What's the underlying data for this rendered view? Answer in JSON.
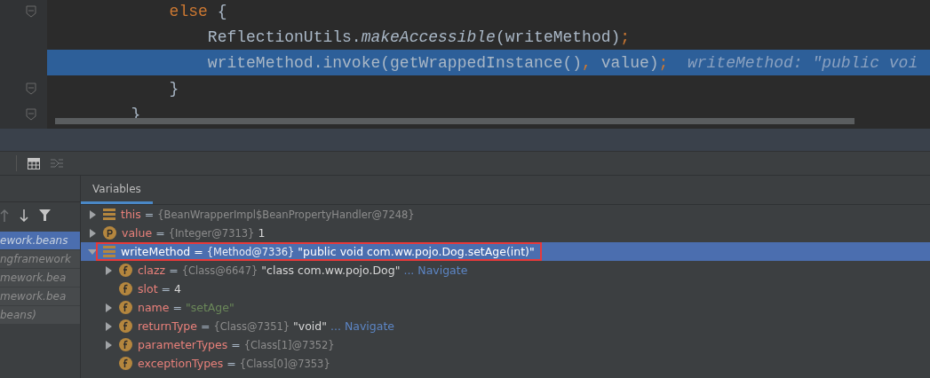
{
  "editor": {
    "lines": [
      {
        "highlighted": false,
        "fold": true,
        "segments": [
          {
            "kind": "keyword",
            "text": "            else"
          },
          {
            "kind": "plain",
            "text": " {"
          }
        ]
      },
      {
        "highlighted": false,
        "fold": false,
        "segments": [
          {
            "kind": "plain",
            "text": "                ReflectionUtils."
          },
          {
            "kind": "italic",
            "text": "makeAccessible"
          },
          {
            "kind": "plain",
            "text": "(writeMethod)"
          },
          {
            "kind": "punct",
            "text": ";"
          }
        ]
      },
      {
        "highlighted": true,
        "fold": false,
        "segments": [
          {
            "kind": "plain",
            "text": "                writeMethod.invoke(getWrappedInstance()"
          },
          {
            "kind": "punct",
            "text": ","
          },
          {
            "kind": "plain",
            "text": " value)"
          },
          {
            "kind": "punct",
            "text": ";"
          },
          {
            "kind": "hint",
            "text": "  writeMethod: \"public voi"
          }
        ]
      },
      {
        "highlighted": false,
        "fold": true,
        "segments": [
          {
            "kind": "plain",
            "text": "            }"
          }
        ]
      },
      {
        "highlighted": false,
        "fold": true,
        "segments": [
          {
            "kind": "plain",
            "text": "        }"
          }
        ]
      }
    ]
  },
  "frames": {
    "items": [
      {
        "label": "ework.beans",
        "selected": true
      },
      {
        "label": "ngframework",
        "selected": false
      },
      {
        "label": "mework.bea",
        "selected": false
      },
      {
        "label": "mework.bea",
        "selected": false
      },
      {
        "label": "beans)",
        "selected": false
      }
    ]
  },
  "variables": {
    "tab": "Variables",
    "items": [
      {
        "name": "this",
        "kind": "object",
        "operator": "=",
        "expanded": false,
        "selected": false,
        "boxed": false,
        "ref": "{BeanWrapperImpl$BeanPropertyHandler@7248}"
      },
      {
        "name": "value",
        "kind": "param",
        "operator": "=",
        "expanded": false,
        "selected": false,
        "boxed": false,
        "ref": "{Integer@7313}",
        "value": "1"
      },
      {
        "name": "writeMethod",
        "kind": "object",
        "operator": "=",
        "expanded": true,
        "selected": true,
        "boxed": true,
        "ref": "{Method@7336}",
        "value": "\"public void com.ww.pojo.Dog.setAge(int)\"",
        "children": [
          {
            "name": "clazz",
            "kind": "field",
            "operator": "=",
            "expanded": false,
            "selected": false,
            "boxed": false,
            "ref": "{Class@6647}",
            "value": "\"class com.ww.pojo.Dog\"",
            "link": "... Navigate"
          },
          {
            "name": "slot",
            "kind": "field",
            "operator": "=",
            "selected": false,
            "boxed": false,
            "value": "4"
          },
          {
            "name": "name",
            "kind": "field",
            "operator": "=",
            "expanded": false,
            "selected": false,
            "boxed": false,
            "string": "\"setAge\""
          },
          {
            "name": "returnType",
            "kind": "field",
            "operator": "=",
            "expanded": false,
            "selected": false,
            "boxed": false,
            "ref": "{Class@7351}",
            "value": "\"void\"",
            "link": "... Navigate"
          },
          {
            "name": "parameterTypes",
            "kind": "field",
            "operator": "=",
            "expanded": false,
            "selected": false,
            "boxed": false,
            "ref": "{Class[1]@7352}"
          },
          {
            "name": "exceptionTypes",
            "kind": "field",
            "operator": "=",
            "selected": false,
            "boxed": false,
            "ref": "{Class[0]@7353}"
          }
        ]
      }
    ]
  }
}
